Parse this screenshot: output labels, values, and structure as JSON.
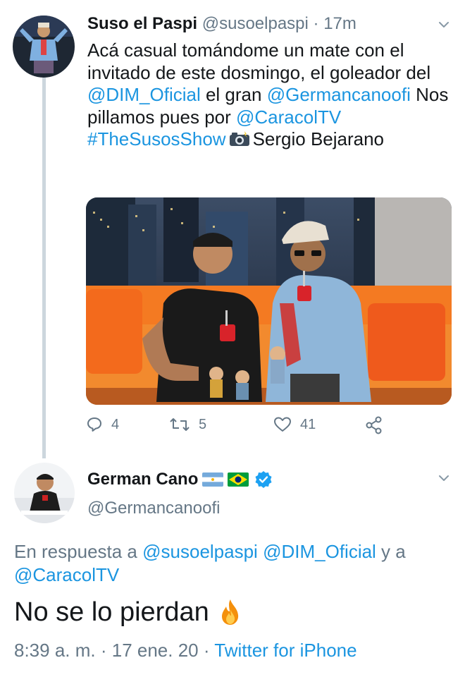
{
  "tweet1": {
    "name": "Suso el Paspi",
    "handle": "@susoelpaspi",
    "separator": "·",
    "time": "17m",
    "text_1": "Acá casual tomándome un mate con el invitado de este dosmingo, el goleador del ",
    "mention_dim": "@DIM_Oficial",
    "text_2": " el gran ",
    "mention_german": "@Germancanoofi",
    "text_3": " Nos pillamos pues por ",
    "mention_caracol": "@CaracolTV",
    "space": " ",
    "hashtag": "#TheSusosShow",
    "text_4": "Sergio Bejarano",
    "camera_icon": "camera-with-flash-emoji",
    "actions": {
      "replies": "4",
      "retweets": "5",
      "likes": "41"
    }
  },
  "tweet2": {
    "name": "German Cano",
    "flags": [
      "argentina-flag",
      "brazil-flag"
    ],
    "verified": true,
    "handle": "@Germancanoofi",
    "reply_prefix": "En respuesta a ",
    "reply_mention_1": "@susoelpaspi",
    "reply_mention_2": "@DIM_Oficial",
    "reply_and": " y a ",
    "reply_mention_3": "@CaracolTV",
    "text": "No se lo pierdan",
    "emoji": "fire-emoji",
    "time": "8:39 a. m.",
    "dot": " · ",
    "date": "17 ene. 20",
    "client": "Twitter for iPhone"
  },
  "colors": {
    "link": "#1b95e0",
    "secondary": "#657786",
    "primary": "#14171a",
    "thread_line": "#ccd6dd",
    "verified": "#1da1f2"
  }
}
